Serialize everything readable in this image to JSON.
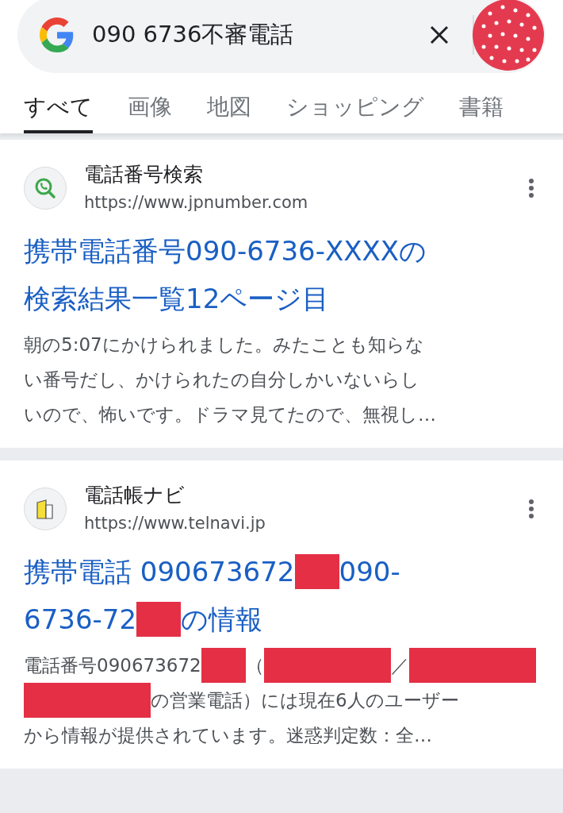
{
  "search": {
    "value": "090 6736不審電話"
  },
  "tabs": [
    {
      "label": "すべて",
      "selected": true
    },
    {
      "label": "画像",
      "selected": false
    },
    {
      "label": "地図",
      "selected": false
    },
    {
      "label": "ショッピング",
      "selected": false
    },
    {
      "label": "書籍",
      "selected": false
    }
  ],
  "results": [
    {
      "kind": "phone",
      "site": "電話番号検索",
      "url": "https://www.jpnumber.com",
      "title_lines": [
        [
          {
            "kind": "text",
            "text": "携帯電話番号090-6736-XXXXの"
          }
        ],
        [
          {
            "kind": "text",
            "text": "検索結果一覧12ページ目"
          }
        ]
      ],
      "snippet_lines": [
        [
          {
            "kind": "text",
            "text": "朝の5:07にかけられました。みたことも知らな"
          }
        ],
        [
          {
            "kind": "text",
            "text": "い番号だし、かけられたの自分しかいないらし"
          }
        ],
        [
          {
            "kind": "text",
            "text": "いので、怖いです。ドラマ見てたので、無視し…"
          }
        ]
      ]
    },
    {
      "kind": "building",
      "site": "電話帳ナビ",
      "url": "https://www.telnavi.jp",
      "title_lines": [
        [
          {
            "kind": "text",
            "text": "携帯電話 090673672"
          },
          {
            "kind": "redaction"
          },
          {
            "kind": "text",
            "text": "090-"
          }
        ],
        [
          {
            "kind": "text",
            "text": "6736-72"
          },
          {
            "kind": "redaction"
          },
          {
            "kind": "text",
            "text": "の情報"
          }
        ]
      ],
      "snippet_lines": [
        [
          {
            "kind": "text",
            "text": "電話番号090673672"
          },
          {
            "kind": "redaction"
          },
          {
            "kind": "text",
            "text": "（"
          },
          {
            "kind": "redaction",
            "wide": true
          },
          {
            "kind": "text",
            "text": "／"
          },
          {
            "kind": "redaction",
            "wide": true
          }
        ],
        [
          {
            "kind": "redaction",
            "wide": true
          },
          {
            "kind": "text",
            "text": "の営業電話）には現在6人のユーザー"
          }
        ],
        [
          {
            "kind": "text",
            "text": "から情報が提供されています。迷惑判定数：全…"
          }
        ]
      ]
    }
  ]
}
